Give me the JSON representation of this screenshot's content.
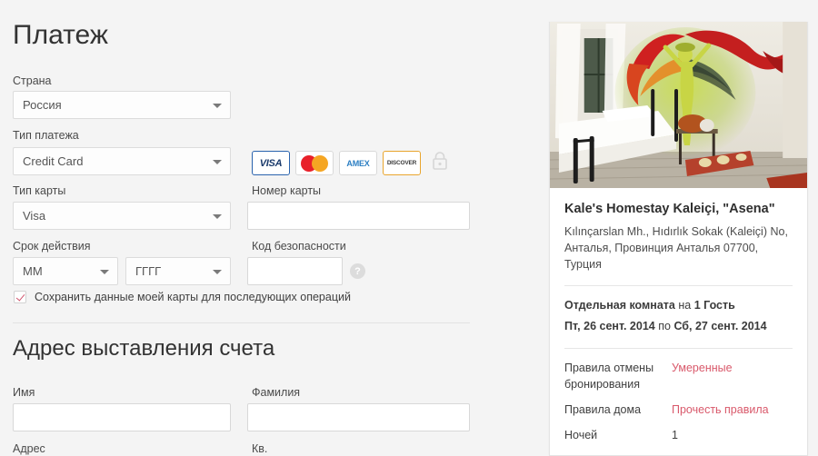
{
  "payment": {
    "heading": "Платеж",
    "country_label": "Страна",
    "country_value": "Россия",
    "payment_type_label": "Тип платежа",
    "payment_type_value": "Credit Card",
    "card_type_label": "Тип карты",
    "card_type_value": "Visa",
    "card_number_label": "Номер карты",
    "card_number_value": "",
    "expiry_label": "Срок действия",
    "expiry_month_value": "ММ",
    "expiry_year_value": "ГГГГ",
    "security_code_label": "Код безопасности",
    "security_code_value": "",
    "save_card_label": "Сохранить данные моей карты для последующих операций",
    "card_brands": [
      {
        "name": "visa-logo",
        "label": "VISA"
      },
      {
        "name": "mastercard-logo",
        "label": ""
      },
      {
        "name": "amex-logo",
        "label": "AMEX"
      },
      {
        "name": "discover-logo",
        "label": "DISCOVER"
      }
    ],
    "lock_icon": "lock-icon",
    "help_icon": "help-icon",
    "help_glyph": "?"
  },
  "billing": {
    "heading": "Адрес выставления счета",
    "first_name_label": "Имя",
    "first_name_value": "",
    "last_name_label": "Фамилия",
    "last_name_value": "",
    "address_label": "Адрес",
    "apartment_label": "Кв."
  },
  "listing": {
    "photo_alt": "room-photo",
    "title": "Kale's Homestay Kaleiçi, \"Asena\"",
    "address": "Kılınçarslan Mh., Hıdırlık Sokak (Kaleiçi) No, Антälья, Провинция Анталья 07700, Турция",
    "address_line1": "Kılınçarslan Mh., Hıdırlık Sokak (Kaleiçi) No,",
    "address_line2": "Анталья, Провинция Анталья 07700,",
    "address_line3": "Турция",
    "room_type": "Отдельная комната",
    "room_guests_prefix": "на",
    "room_guests": "1 Гость",
    "date_from": "Пт, 26 сент. 2014",
    "date_sep": "по",
    "date_to": "Сб, 27 сент. 2014",
    "details": [
      {
        "key": "Правила отмены бронирования",
        "value": "Умеренные",
        "accent": true
      },
      {
        "key": "Правила дома",
        "value": "Прочесть правила",
        "accent": true
      },
      {
        "key": "Ночей",
        "value": "1",
        "accent": false
      }
    ]
  },
  "colors": {
    "accent": "#d9596b",
    "page_bg": "#f4f4f4",
    "text": "#3a3a3a",
    "border": "#d8d8d8"
  }
}
